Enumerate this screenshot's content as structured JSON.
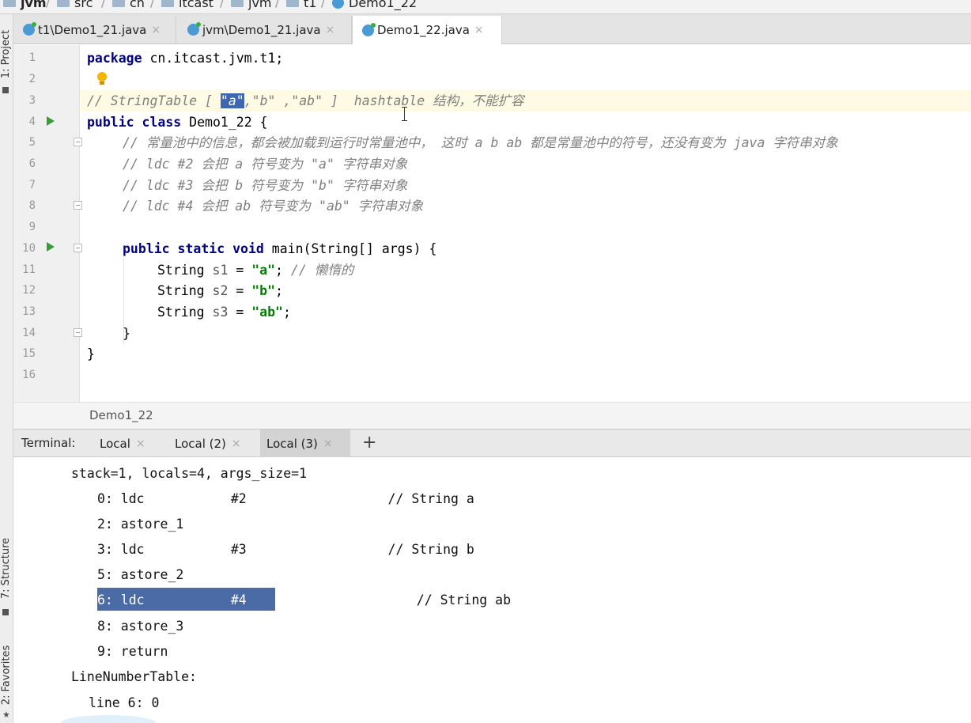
{
  "breadcrumb": {
    "items": [
      "jvm",
      "src",
      "cn",
      "itcast",
      "jvm",
      "t1",
      "Demo1_22"
    ]
  },
  "left_strip": {
    "project_label": "1: Project",
    "structure_label": "7: Structure",
    "favorites_label": "2: Favorites"
  },
  "tabs": [
    {
      "label": "t1\\Demo1_21.java",
      "active": false
    },
    {
      "label": "jvm\\Demo1_21.java",
      "active": false
    },
    {
      "label": "Demo1_22.java",
      "active": true
    }
  ],
  "tab_close_glyph": "×",
  "editor": {
    "line_numbers": [
      "1",
      "2",
      "3",
      "4",
      "5",
      "6",
      "7",
      "8",
      "9",
      "10",
      "11",
      "12",
      "13",
      "14",
      "15",
      "16"
    ],
    "line1": {
      "kw": "package",
      "rest": " cn.itcast.jvm.t1;"
    },
    "line3": {
      "pre": "// StringTable [ ",
      "sel": "\"a\"",
      "post": ",\"b\" ,\"ab\" ]  hashtable 结构，不能扩容"
    },
    "line4": {
      "kw1": "public",
      "kw2": "class",
      "rest": " Demo1_22 {"
    },
    "line5": "// 常量池中的信息，都会被加载到运行时常量池中， 这时 a b ab 都是常量池中的符号，还没有变为 java 字符串对象",
    "line6": "// ldc #2 会把 a 符号变为 \"a\" 字符串对象",
    "line7": "// ldc #3 会把 b 符号变为 \"b\" 字符串对象",
    "line8": "// ldc #4 会把 ab 符号变为 \"ab\" 字符串对象",
    "line10": {
      "kw1": "public",
      "kw2": "static",
      "kw3": "void",
      "rest": " main(String[] args) {"
    },
    "line11": {
      "type": "String",
      "var": "s1",
      "eq": " = ",
      "str": "\"a\"",
      "semi": ";",
      "comment": " // 懒惰的"
    },
    "line12": {
      "type": "String",
      "var": "s2",
      "eq": " = ",
      "str": "\"b\"",
      "semi": ";"
    },
    "line13": {
      "type": "String",
      "var": "s3",
      "eq": " = ",
      "str": "\"ab\"",
      "semi": ";"
    },
    "line14": "}",
    "line15": "}",
    "footer_breadcrumb": "Demo1_22"
  },
  "terminal": {
    "label": "Terminal:",
    "tabs": [
      {
        "label": "Local",
        "active": false
      },
      {
        "label": "Local (2)",
        "active": false
      },
      {
        "label": "Local (3)",
        "active": true
      }
    ],
    "add_glyph": "+",
    "lines": [
      "stack=1, locals=4, args_size=1",
      "0: ldc           #2                  // String a",
      "2: astore_1",
      "3: ldc           #3                  // String b",
      "5: astore_2",
      "6: ldc           #4                  // String ab",
      "8: astore_3",
      "9: return",
      "LineNumberTable:",
      "line 6: 0"
    ],
    "highlighted_text": "6: ldc           #4",
    "highlighted_rest": "                  // String ab"
  },
  "colors": {
    "keyword": "#000080",
    "comment": "#808080",
    "string": "#008000",
    "selection": "#3e67b1",
    "run_icon": "#3a9b3a"
  }
}
